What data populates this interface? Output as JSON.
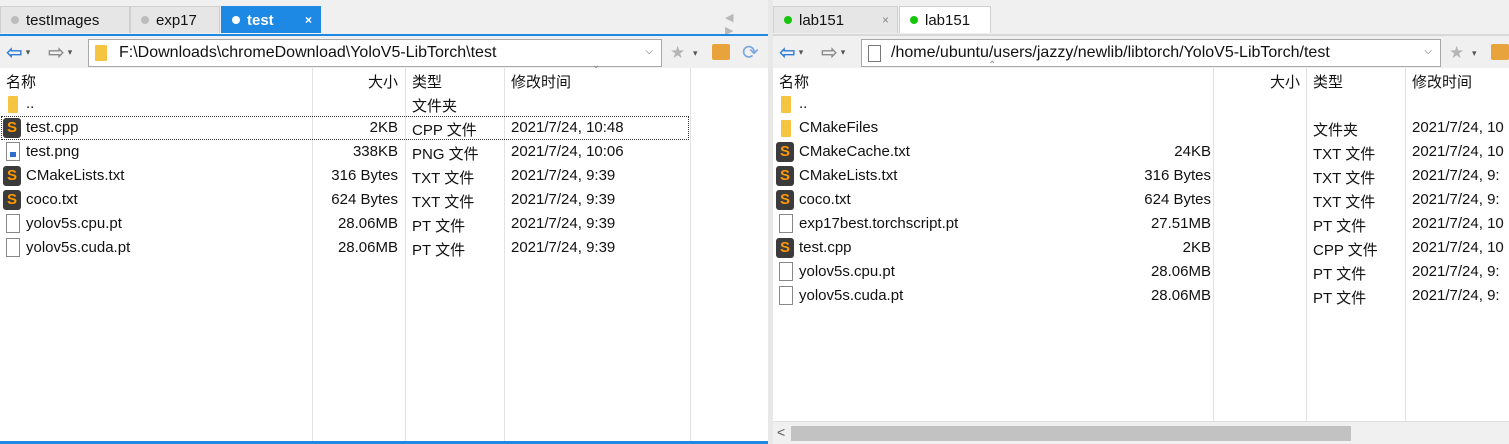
{
  "left": {
    "tabs": [
      {
        "label": "testImages",
        "state": "inactive"
      },
      {
        "label": "exp17",
        "state": "inactive"
      },
      {
        "label": "test",
        "state": "active",
        "close": "×"
      }
    ],
    "tab_arrows": "◀ ▶",
    "nav": {
      "back": "⇦",
      "fwd": "⇨",
      "caret": "▾"
    },
    "path": "F:\\Downloads\\chromeDownload\\YoloV5-LibTorch\\test",
    "path_dropdown": "⌵",
    "columns": {
      "name": "名称",
      "size": "大小",
      "type": "类型",
      "modified": "修改时间"
    },
    "rows": [
      {
        "icon": "folder",
        "name": "..",
        "size": "",
        "type": "文件夹",
        "modified": ""
      },
      {
        "icon": "sublime",
        "name": "test.cpp",
        "size": "2KB",
        "type": "CPP 文件",
        "modified": "2021/7/24, 10:48",
        "selected": true
      },
      {
        "icon": "png",
        "name": "test.png",
        "size": "338KB",
        "type": "PNG 文件",
        "modified": "2021/7/24, 10:06"
      },
      {
        "icon": "sublime",
        "name": "CMakeLists.txt",
        "size": "316 Bytes",
        "type": "TXT 文件",
        "modified": "2021/7/24, 9:39"
      },
      {
        "icon": "sublime",
        "name": "coco.txt",
        "size": "624 Bytes",
        "type": "TXT 文件",
        "modified": "2021/7/24, 9:39"
      },
      {
        "icon": "file",
        "name": "yolov5s.cpu.pt",
        "size": "28.06MB",
        "type": "PT 文件",
        "modified": "2021/7/24, 9:39"
      },
      {
        "icon": "file",
        "name": "yolov5s.cuda.pt",
        "size": "28.06MB",
        "type": "PT 文件",
        "modified": "2021/7/24, 9:39"
      }
    ]
  },
  "right": {
    "tabs": [
      {
        "label": "lab151",
        "state": "inactive",
        "close": "×"
      },
      {
        "label": "lab151",
        "state": "active"
      }
    ],
    "nav": {
      "back": "⇦",
      "fwd": "⇨",
      "caret": "▾"
    },
    "path": "/home/ubuntu/users/jazzy/newlib/libtorch/YoloV5-LibTorch/test",
    "path_dropdown": "⌵",
    "columns": {
      "name": "名称",
      "size": "大小",
      "type": "类型",
      "modified": "修改时间"
    },
    "rows": [
      {
        "icon": "folder",
        "name": "..",
        "size": "",
        "type": "",
        "modified": ""
      },
      {
        "icon": "folder",
        "name": "CMakeFiles",
        "size": "",
        "type": "文件夹",
        "modified": "2021/7/24, 10"
      },
      {
        "icon": "sublime",
        "name": "CMakeCache.txt",
        "size": "24KB",
        "type": "TXT 文件",
        "modified": "2021/7/24, 10"
      },
      {
        "icon": "sublime",
        "name": "CMakeLists.txt",
        "size": "316 Bytes",
        "type": "TXT 文件",
        "modified": "2021/7/24, 9:"
      },
      {
        "icon": "sublime",
        "name": "coco.txt",
        "size": "624 Bytes",
        "type": "TXT 文件",
        "modified": "2021/7/24, 9:"
      },
      {
        "icon": "file",
        "name": "exp17best.torchscript.pt",
        "size": "27.51MB",
        "type": "PT 文件",
        "modified": "2021/7/24, 10"
      },
      {
        "icon": "sublime",
        "name": "test.cpp",
        "size": "2KB",
        "type": "CPP 文件",
        "modified": "2021/7/24, 10"
      },
      {
        "icon": "file",
        "name": "yolov5s.cpu.pt",
        "size": "28.06MB",
        "type": "PT 文件",
        "modified": "2021/7/24, 9:"
      },
      {
        "icon": "file",
        "name": "yolov5s.cuda.pt",
        "size": "28.06MB",
        "type": "PT 文件",
        "modified": "2021/7/24, 9:"
      }
    ],
    "scroll_arrow": "<"
  },
  "icons": {
    "star": "★",
    "refresh": "⟳",
    "sublime": "S",
    "sort": "⌃"
  },
  "colors": {
    "accent": "#1e88e5",
    "green_dot": "#16c60c",
    "folder": "#f5c542"
  }
}
